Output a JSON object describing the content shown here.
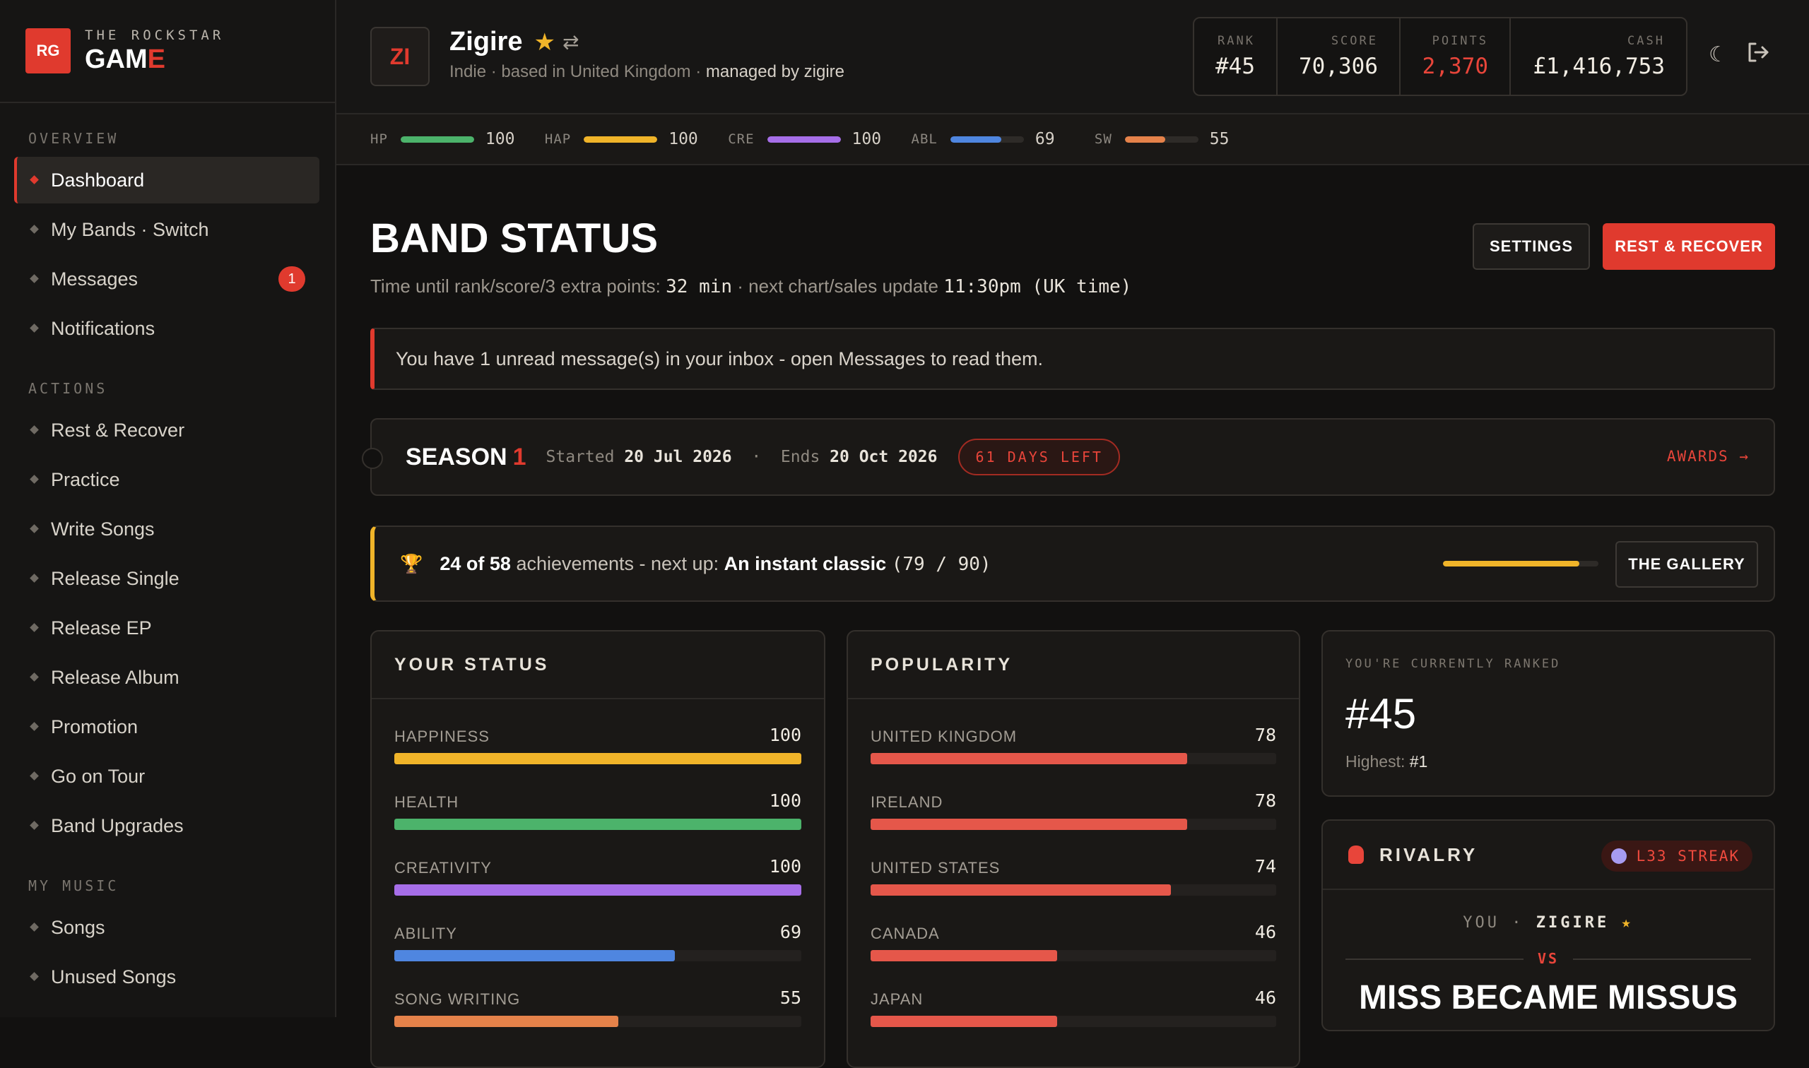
{
  "brand": {
    "logo": "RG",
    "top": "THE ROCKSTAR",
    "bottom_main": "GAM",
    "bottom_accent": "E"
  },
  "sidebar": {
    "sections": [
      {
        "title": "OVERVIEW",
        "items": [
          {
            "label": "Dashboard",
            "active": true
          },
          {
            "label": "My Bands · Switch"
          },
          {
            "label": "Messages",
            "badge": "1"
          },
          {
            "label": "Notifications"
          }
        ]
      },
      {
        "title": "ACTIONS",
        "items": [
          {
            "label": "Rest & Recover"
          },
          {
            "label": "Practice"
          },
          {
            "label": "Write Songs"
          },
          {
            "label": "Release Single"
          },
          {
            "label": "Release EP"
          },
          {
            "label": "Release Album"
          },
          {
            "label": "Promotion"
          },
          {
            "label": "Go on Tour"
          },
          {
            "label": "Band Upgrades"
          }
        ]
      },
      {
        "title": "MY MUSIC",
        "items": [
          {
            "label": "Songs"
          },
          {
            "label": "Unused Songs"
          }
        ]
      }
    ]
  },
  "header": {
    "avatar": "ZI",
    "band_name": "Zigire",
    "star_icon": "star-icon",
    "swap_icon": "swap-icon",
    "subtitle": "Indie · based in United Kingdom · ",
    "managed_by": "managed by zigire",
    "stats": [
      {
        "label": "RANK",
        "value": "#45"
      },
      {
        "label": "SCORE",
        "value": "70,306"
      },
      {
        "label": "POINTS",
        "value": "2,370",
        "color": "#e8453a"
      },
      {
        "label": "CASH",
        "value": "£1,416,753"
      }
    ]
  },
  "strip": [
    {
      "label": "HP",
      "value": 100,
      "color": "#4cb36b"
    },
    {
      "label": "HAP",
      "value": 100,
      "color": "#f0b429"
    },
    {
      "label": "CRE",
      "value": 100,
      "color": "#a66ee8"
    },
    {
      "label": "ABL",
      "value": 69,
      "color": "#4f86e0"
    },
    {
      "label": "SW",
      "value": 55,
      "color": "#e5824a"
    }
  ],
  "main": {
    "title": "BAND STATUS",
    "timer_prefix": "Time until rank/score/3 extra points: ",
    "timer_value": "32 min",
    "timer_mid": " · next chart/sales update ",
    "timer_update": "11:30pm (UK time)",
    "settings_label": "SETTINGS",
    "rest_label": "REST & RECOVER",
    "alert": "You have 1 unread message(s) in your inbox - open Messages to read them."
  },
  "season": {
    "title": "SEASON",
    "number": "1",
    "started_label": "Started",
    "started": "20 Jul 2026",
    "sep": "·",
    "ends_label": "Ends",
    "ends": "20 Oct 2026",
    "days_left": "61 DAYS LEFT",
    "awards": "AWARDS →"
  },
  "achievements": {
    "count": "24 of 58",
    "text": " achievements - next up: ",
    "next": "An instant classic",
    "progress": "(79 / 90)",
    "fraction": 0.878,
    "gallery_label": "THE GALLERY"
  },
  "your_status": {
    "title": "YOUR STATUS",
    "rows": [
      {
        "label": "HAPPINESS",
        "value": 100,
        "color": "#f0b429"
      },
      {
        "label": "HEALTH",
        "value": 100,
        "color": "#4cb36b"
      },
      {
        "label": "CREATIVITY",
        "value": 100,
        "color": "#a66ee8"
      },
      {
        "label": "ABILITY",
        "value": 69,
        "color": "#4f86e0"
      },
      {
        "label": "SONG WRITING",
        "value": 55,
        "color": "#e5824a"
      }
    ]
  },
  "popularity": {
    "title": "POPULARITY",
    "rows": [
      {
        "label": "UNITED KINGDOM",
        "value": 78,
        "color": "#e5574a"
      },
      {
        "label": "IRELAND",
        "value": 78,
        "color": "#e5574a"
      },
      {
        "label": "UNITED STATES",
        "value": 74,
        "color": "#e5574a"
      },
      {
        "label": "CANADA",
        "value": 46,
        "color": "#e5574a"
      },
      {
        "label": "JAPAN",
        "value": 46,
        "color": "#e5574a"
      }
    ]
  },
  "ranked": {
    "label": "YOU'RE CURRENTLY RANKED",
    "value": "#45",
    "highest_label": "Highest: ",
    "highest": "#1"
  },
  "rivalry": {
    "title": "RIVALRY",
    "streak": "L33 STREAK",
    "you_label": "YOU",
    "sep": " · ",
    "you_name": "ZIGIRE",
    "vs": "VS",
    "rival": "MISS BECAME MISSUS"
  }
}
